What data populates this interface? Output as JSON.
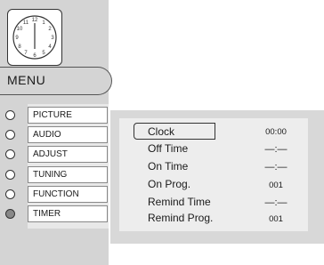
{
  "menu": {
    "title": "MENU"
  },
  "sidebar": {
    "items": [
      {
        "label": "PICTURE",
        "selected": false
      },
      {
        "label": "AUDIO",
        "selected": false
      },
      {
        "label": "ADJUST",
        "selected": false
      },
      {
        "label": "TUNING",
        "selected": false
      },
      {
        "label": "FUNCTION",
        "selected": false
      },
      {
        "label": "TIMER",
        "selected": true
      }
    ]
  },
  "timer": {
    "rows": [
      {
        "label": "Clock",
        "value": "00:00"
      },
      {
        "label": "Off Time",
        "value": "—:—"
      },
      {
        "label": "On Time",
        "value": "—:—"
      },
      {
        "label": "On Prog.",
        "value": "001"
      },
      {
        "label": "Remind Time",
        "value": "—:—"
      },
      {
        "label": "Remind Prog.",
        "value": "001"
      }
    ]
  },
  "colors": {
    "selected_radio": "#888888",
    "panel": "#d8d8d8"
  },
  "icons": {
    "clock": "clock-icon"
  }
}
